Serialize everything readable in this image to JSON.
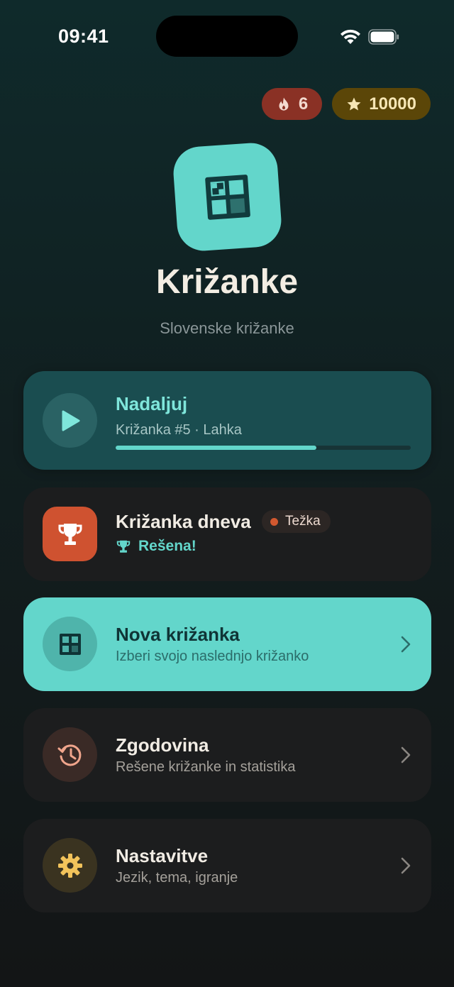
{
  "status_bar": {
    "time": "09:41"
  },
  "badges": {
    "streak": "6",
    "points": "10000"
  },
  "header": {
    "title": "Križanke",
    "subtitle": "Slovenske križanke"
  },
  "continue_card": {
    "title": "Nadaljuj",
    "subtitle": "Križanka #5 · Lahka",
    "progress": 0.68
  },
  "daily_card": {
    "title": "Križanka dneva",
    "difficulty": "Težka",
    "status": "Rešena!"
  },
  "new_card": {
    "title": "Nova križanka",
    "subtitle": "Izberi svojo naslednjo križanko"
  },
  "history_card": {
    "title": "Zgodovina",
    "subtitle": "Rešene križanke in statistika"
  },
  "settings_card": {
    "title": "Nastavitve",
    "subtitle": "Jezik, tema, igranje"
  },
  "colors": {
    "accent": "#63d6cb",
    "streak": "#8a3125",
    "points": "#5b4608",
    "daily": "#cf5230"
  }
}
